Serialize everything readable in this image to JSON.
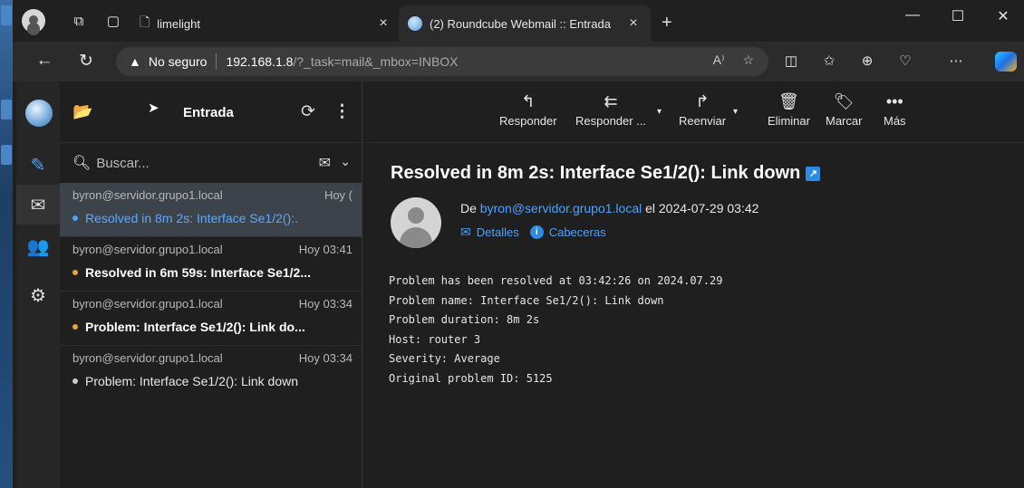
{
  "browser": {
    "tabs": [
      {
        "title": "limelight",
        "active": false
      },
      {
        "title": "(2) Roundcube Webmail :: Entrada",
        "active": true
      }
    ],
    "address": {
      "security_label": "No seguro",
      "host": "192.168.1.8",
      "path": "/?_task=mail&_mbox=INBOX"
    }
  },
  "mail": {
    "folder_title": "Entrada",
    "search_placeholder": "Buscar...",
    "messages": [
      {
        "from": "byron@servidor.grupo1.local",
        "date": "Hoy (",
        "subject": "Resolved in 8m 2s: Interface Se1/2():.",
        "selected": true,
        "unread": false,
        "dot_color": "#4aa3ff"
      },
      {
        "from": "byron@servidor.grupo1.local",
        "date": "Hoy 03:41",
        "subject": "Resolved in 6m 59s: Interface Se1/2...",
        "selected": false,
        "unread": true,
        "dot_color": "#e8a33a"
      },
      {
        "from": "byron@servidor.grupo1.local",
        "date": "Hoy 03:34",
        "subject": "Problem: Interface Se1/2(): Link do...",
        "selected": false,
        "unread": true,
        "dot_color": "#e8a33a"
      },
      {
        "from": "byron@servidor.grupo1.local",
        "date": "Hoy 03:34",
        "subject": "Problem: Interface Se1/2(): Link down",
        "selected": false,
        "unread": false,
        "dot_color": "#cccccc"
      }
    ]
  },
  "toolbar": {
    "reply": "Responder",
    "reply_all": "Responder ...",
    "forward": "Reenviar",
    "delete": "Eliminar",
    "mark": "Marcar",
    "more": "Más"
  },
  "message": {
    "subject": "Resolved in 8m 2s: Interface Se1/2(): Link down",
    "from_prefix": "De",
    "from_address": "byron@servidor.grupo1.local",
    "date_text": "el 2024-07-29 03:42",
    "details_link": "Detalles",
    "headers_link": "Cabeceras",
    "body_lines": [
      "Problem has been resolved at 03:42:26 on 2024.07.29",
      "Problem name: Interface Se1/2(): Link down",
      "Problem duration: 8m 2s",
      "Host: router 3",
      "Severity: Average",
      "Original problem ID: 5125"
    ]
  },
  "colors": {
    "link": "#4aa3ff",
    "accent": "#2b8be6",
    "unread_dot": "#e8a33a"
  }
}
